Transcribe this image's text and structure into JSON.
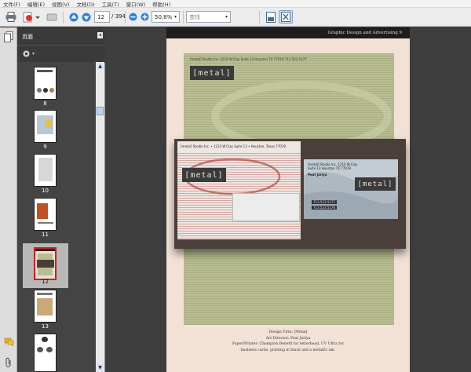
{
  "menu": [
    "文件(F)",
    "编辑(E)",
    "视图(V)",
    "文档(D)",
    "工具(T)",
    "窗口(W)",
    "帮助(H)"
  ],
  "toolbar": {
    "page_current": "12",
    "page_total": "/ 394",
    "zoom": "50.8%",
    "find_placeholder": "查找"
  },
  "nav_panel": {
    "title": "页面",
    "thumbnails": [
      {
        "label": "8"
      },
      {
        "label": "9"
      },
      {
        "label": "10"
      },
      {
        "label": "11"
      },
      {
        "label": "12",
        "selected": true
      },
      {
        "label": "13"
      }
    ]
  },
  "page": {
    "running_head": "Graphic Design and Advertising   9",
    "logo_text": "[metal]",
    "letterhead_line": "[metal] Studio Inc. 1210 W.Clay Suite 13 Houston TX 77019  713.523.5177",
    "envelope_return": "[metal] Studio Inc. • 1210 W.Clay Suite 13 • Houston, Texas 77019",
    "card_line1": "[metal] Studio Inc. 1210 W.Clay",
    "card_line2": "Suite 13 Houston TX 77019",
    "card_name": "Peat Jariya",
    "card_phone1": "713.523.5177",
    "card_phone2": "713.523.5176",
    "caption": {
      "l1": "Design Firm: [Metal]",
      "l2": "Art Director: Peat Jariya",
      "l3": "Paper/Printer: Champion Benefit for letterhead, UV Ultra for",
      "l4": "business cards; printing in black and a metallic ink."
    }
  },
  "colors": {
    "accent_blue": "#1f6fd1",
    "selected_thumb": "#cc1f1f",
    "panel_dark": "#3a3a3a"
  }
}
